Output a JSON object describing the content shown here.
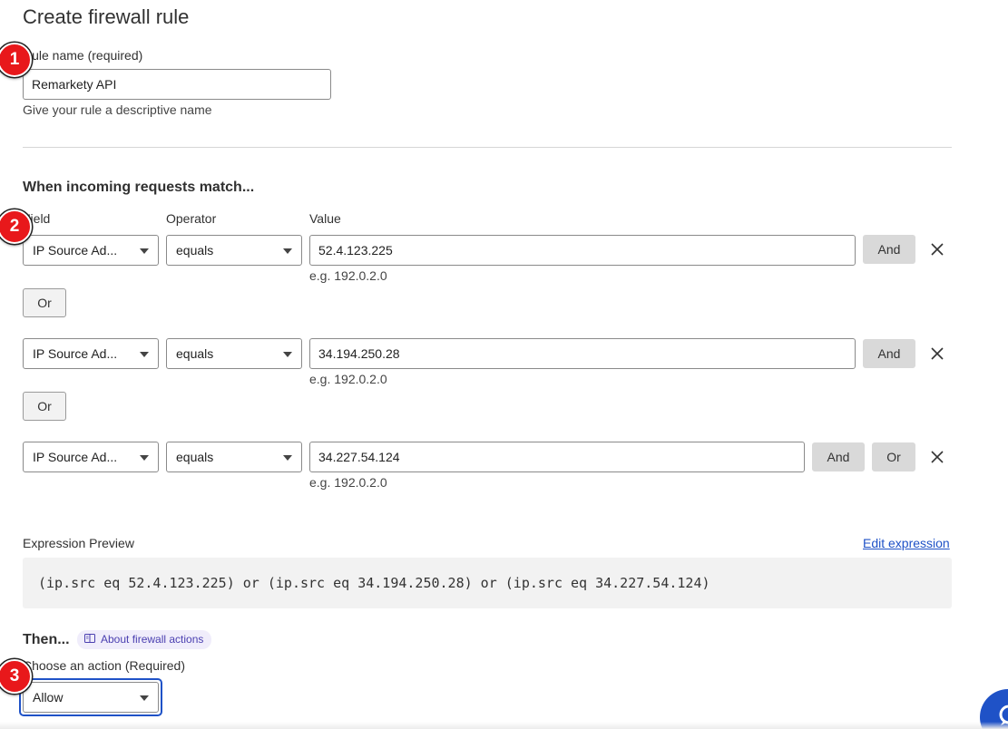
{
  "page": {
    "title": "Create firewall rule"
  },
  "rule_name": {
    "label": "Rule name (required)",
    "value": "Remarkety API",
    "hint": "Give your rule a descriptive name"
  },
  "match": {
    "heading": "When incoming requests match...",
    "col_field": "Field",
    "col_operator": "Operator",
    "col_value": "Value",
    "rows": [
      {
        "field": "IP Source Ad...",
        "operator": "equals",
        "value": "52.4.123.225",
        "example": "e.g. 192.0.2.0",
        "and_label": "And"
      },
      {
        "field": "IP Source Ad...",
        "operator": "equals",
        "value": "34.194.250.28",
        "example": "e.g. 192.0.2.0",
        "and_label": "And"
      },
      {
        "field": "IP Source Ad...",
        "operator": "equals",
        "value": "34.227.54.124",
        "example": "e.g. 192.0.2.0",
        "and_label": "And",
        "or_label": "Or"
      }
    ],
    "or_label": "Or"
  },
  "preview": {
    "label": "Expression Preview",
    "edit_link": "Edit expression",
    "expression": "(ip.src eq 52.4.123.225) or (ip.src eq 34.194.250.28) or (ip.src eq 34.227.54.124)"
  },
  "then": {
    "heading": "Then...",
    "about_link": "About firewall actions",
    "action_label": "Choose an action (Required)",
    "action_value": "Allow"
  },
  "badges": [
    "1",
    "2",
    "3"
  ],
  "colors": {
    "accent": "#1f52c7",
    "badge": "#e8181b",
    "pill_bg": "#f0edfb"
  }
}
